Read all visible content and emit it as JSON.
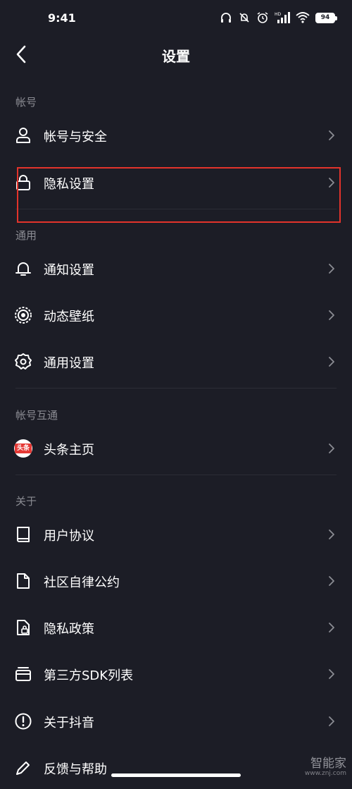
{
  "status_bar": {
    "time": "9:41",
    "battery": "94",
    "network_badge": "HD"
  },
  "header": {
    "title": "设置"
  },
  "sections": [
    {
      "title": "帐号",
      "items": [
        {
          "label": "帐号与安全",
          "icon": "user-icon"
        },
        {
          "label": "隐私设置",
          "icon": "lock-icon"
        }
      ]
    },
    {
      "title": "通用",
      "items": [
        {
          "label": "通知设置",
          "icon": "bell-icon"
        },
        {
          "label": "动态壁纸",
          "icon": "wallpaper-icon"
        },
        {
          "label": "通用设置",
          "icon": "gear-icon"
        }
      ]
    },
    {
      "title": "帐号互通",
      "items": [
        {
          "label": "头条主页",
          "icon": "toutiao-logo-icon",
          "logo_text": "头条"
        }
      ]
    },
    {
      "title": "关于",
      "items": [
        {
          "label": "用户协议",
          "icon": "book-icon"
        },
        {
          "label": "社区自律公约",
          "icon": "document-icon"
        },
        {
          "label": "隐私政策",
          "icon": "privacy-document-icon"
        },
        {
          "label": "第三方SDK列表",
          "icon": "card-stack-icon"
        },
        {
          "label": "关于抖音",
          "icon": "info-icon"
        },
        {
          "label": "反馈与帮助",
          "icon": "edit-icon"
        }
      ]
    }
  ],
  "watermark": {
    "text": "智能家",
    "sub": "www.znj.com"
  },
  "colors": {
    "background": "#1c1d26",
    "highlight": "#e2332b",
    "section_text": "#8b8c93"
  }
}
